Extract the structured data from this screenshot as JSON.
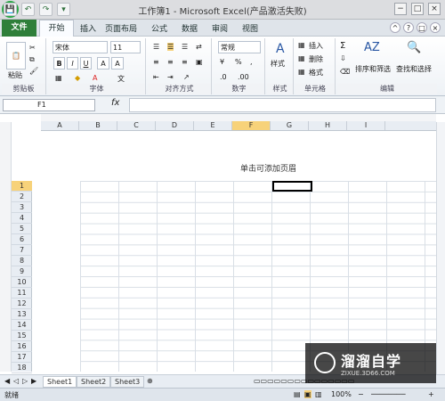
{
  "window": {
    "title": "工作簿1 - Microsoft Excel(产品激活失败)",
    "min": "−",
    "max": "□",
    "close": "×"
  },
  "qat": {
    "save": "💾",
    "undo": "↶",
    "redo": "↷",
    "more": "▾"
  },
  "tabs": [
    "文件",
    "开始",
    "插入",
    "页面布局",
    "公式",
    "数据",
    "审阅",
    "视图"
  ],
  "ribbon": {
    "clipboard": {
      "label": "剪贴板",
      "paste": "粘贴"
    },
    "font": {
      "label": "字体",
      "font_name": "宋体",
      "font_size": "11",
      "bold": "B",
      "italic": "I",
      "underline": "U",
      "grow": "A",
      "shrink": "A"
    },
    "alignment": {
      "label": "对齐方式"
    },
    "number": {
      "label": "数字",
      "format": "常规",
      "percent": "%",
      "comma": ","
    },
    "styles": {
      "label": "样式",
      "button": "样式"
    },
    "cells": {
      "label": "单元格",
      "insert": "插入",
      "delete": "删除",
      "format": "格式"
    },
    "editing": {
      "label": "编辑",
      "sort": "排序和筛选",
      "find": "查找和选择",
      "sum": "Σ"
    }
  },
  "formula_bar": {
    "name_box": "F1",
    "fx": "fx",
    "content": ""
  },
  "columns": [
    "A",
    "B",
    "C",
    "D",
    "E",
    "F",
    "G",
    "H",
    "I"
  ],
  "rows": [
    "1",
    "2",
    "3",
    "4",
    "5",
    "6",
    "7",
    "8",
    "9",
    "10",
    "11",
    "12",
    "13",
    "14",
    "15",
    "16",
    "17",
    "18"
  ],
  "sheet": {
    "header_hint": "单击可添加页眉",
    "selected_cell": "F1"
  },
  "sheet_tabs": [
    "Sheet1",
    "Sheet2",
    "Sheet3"
  ],
  "status": {
    "left": "就绪",
    "zoom": "100%"
  },
  "watermark": {
    "main": "溜溜自学",
    "sub": "ZIXUE.3D66.COM"
  }
}
